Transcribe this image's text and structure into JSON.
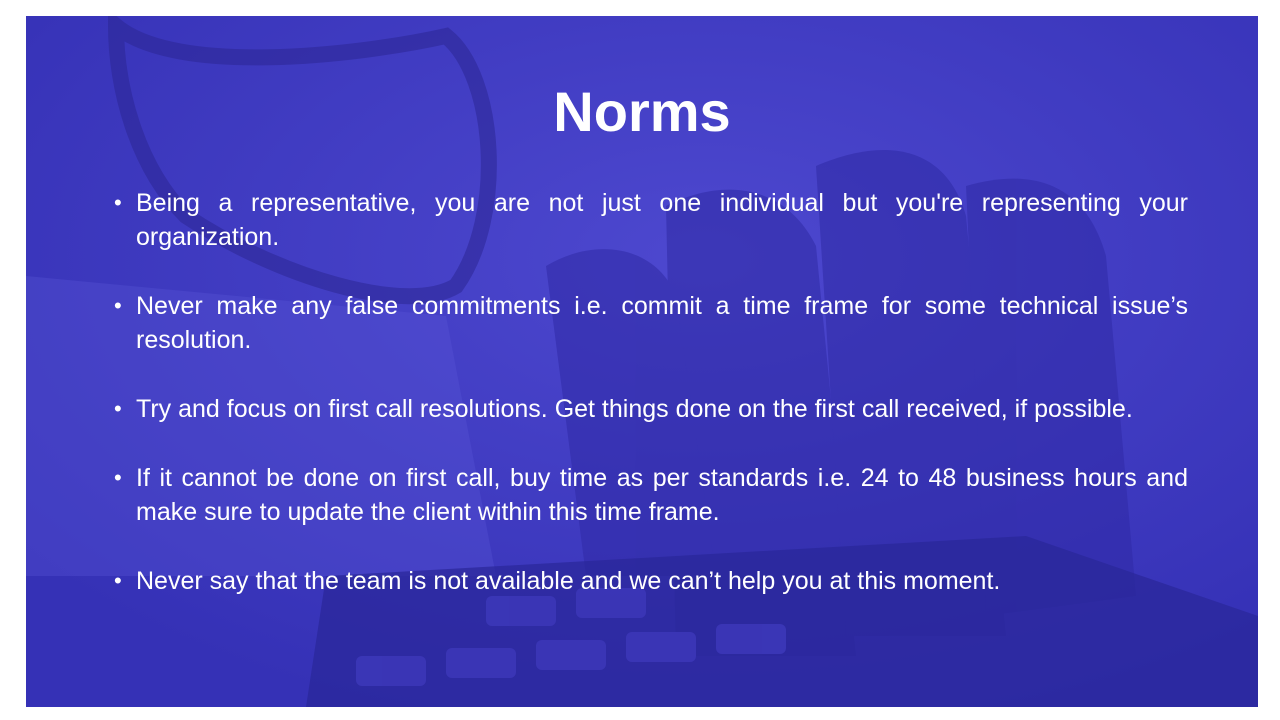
{
  "slide": {
    "title": "Norms",
    "bullets": [
      "Being a representative, you are not just one individual but you're representing your organization.",
      "Never make any false commitments i.e. commit a time frame for some technical issue’s resolution.",
      "Try and focus on first call resolutions. Get things done on the first call received, if possible.",
      "If it cannot be done on first call, buy time as per standards i.e. 24 to 48 business hours and make sure to update the client within this time frame.",
      "Never say that the team is not available and we can’t help you at this moment."
    ]
  },
  "background": {
    "overlay_color": "#3f3ac4",
    "image_subject": "hand-on-calculator-with-glasses"
  }
}
